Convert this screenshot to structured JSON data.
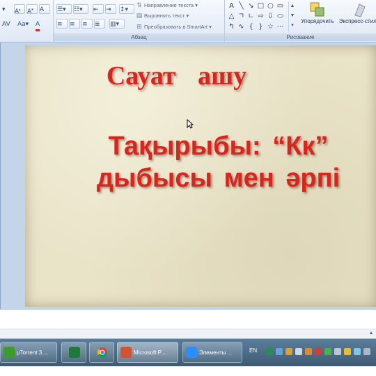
{
  "ribbon": {
    "paragraph_group_label": "Абзац",
    "drawing_group_label": "Рисование",
    "text_direction_label": "Направление текста",
    "align_text_label": "Выровнять текст",
    "smartart_label": "Преобразовать в SmartArt",
    "arrange_label": "Упорядочить",
    "quick_styles_label": "Экспресс-стили"
  },
  "slide": {
    "title": "Сауат ашу",
    "body_line1": "Тақырыбы: “Кк”",
    "body_line2": "дыбысы мен әрпі"
  },
  "taskbar": {
    "tasks": [
      {
        "label": "µTorrent 3...."
      },
      {
        "label": ""
      },
      {
        "label": ""
      },
      {
        "label": "Microsoft P..."
      },
      {
        "label": "Элементы ..."
      }
    ],
    "language": "EN"
  },
  "colors": {
    "title_red": "#d6261d",
    "slide_bg": "#e9e3c8",
    "workspace_bg": "#c4d4e9",
    "taskbar": "#4a6a86"
  },
  "icons": [
    "font-size-up-icon",
    "font-size-down-icon",
    "clear-format-icon",
    "bullets-icon",
    "numbering-icon",
    "indent-decrease-icon",
    "indent-increase-icon",
    "line-spacing-icon",
    "align-left-icon",
    "align-center-icon",
    "align-right-icon",
    "justify-icon",
    "columns-icon",
    "shapes-gallery-icon",
    "arrange-icon",
    "quick-styles-icon",
    "utorrent-icon",
    "camtasia-icon",
    "chrome-icon",
    "powerpoint-icon",
    "zoom-icon"
  ]
}
